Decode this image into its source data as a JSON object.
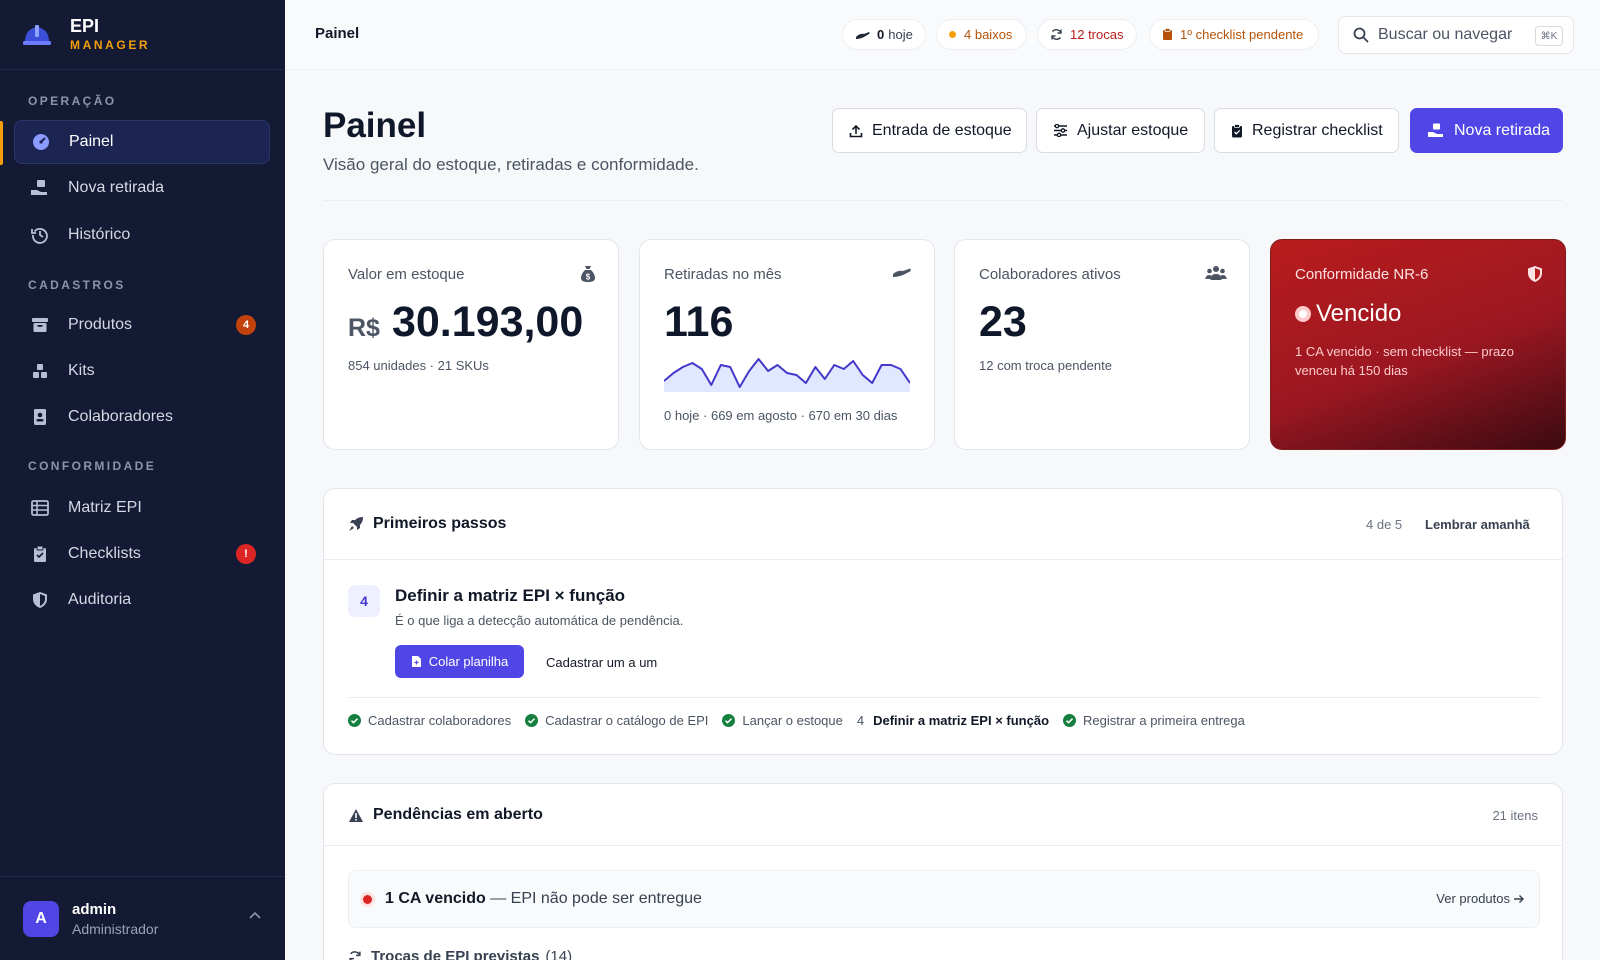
{
  "brand": {
    "name": "EPI",
    "sub": "MANAGER"
  },
  "nav": {
    "section_operacao": "OPERAÇÃO",
    "painel": "Painel",
    "nova_retirada": "Nova retirada",
    "historico": "Histórico",
    "section_cadastros": "CADASTROS",
    "produtos": "Produtos",
    "produtos_badge": "4",
    "kits": "Kits",
    "colaboradores": "Colaboradores",
    "section_conformidade": "CONFORMIDADE",
    "matriz": "Matriz EPI",
    "checklists": "Checklists",
    "checklists_badge": "!",
    "auditoria": "Auditoria"
  },
  "user": {
    "initial": "A",
    "name": "admin",
    "role": "Administrador"
  },
  "topbar": {
    "breadcrumb": "Painel",
    "pill_hoje_num": "0",
    "pill_hoje_label": "hoje",
    "pill_baixos": "4 baixos",
    "pill_trocas": "12 trocas",
    "pill_checklist": "1º checklist pendente",
    "search_placeholder": "Buscar ou navegar",
    "search_kbd": "⌘K"
  },
  "header": {
    "title": "Painel",
    "subtitle": "Visão geral do estoque, retiradas e conformidade.",
    "btn_entrada": "Entrada de estoque",
    "btn_ajustar": "Ajustar estoque",
    "btn_checklist": "Registrar checklist",
    "btn_nova": "Nova retirada"
  },
  "cards": {
    "valor": {
      "label": "Valor em estoque",
      "currency": "R$",
      "value": "30.193,00",
      "sub": "854 unidades · 21 SKUs"
    },
    "retiradas": {
      "label": "Retiradas no mês",
      "value": "116",
      "sub": "0 hoje · 669 em agosto · 670 em 30 dias"
    },
    "colaboradores": {
      "label": "Colaboradores ativos",
      "value": "23",
      "sub": "12 com troca pendente"
    },
    "conformidade": {
      "label": "Conformidade NR-6",
      "status": "Vencido",
      "sub1": "1 CA vencido · sem checklist — prazo",
      "sub2": "venceu há 150 dias"
    }
  },
  "sparkline": [
    4,
    8,
    11,
    13,
    10,
    2,
    12,
    11,
    1,
    9,
    15,
    9,
    12,
    8,
    7,
    3,
    11,
    5,
    12,
    10,
    14,
    7,
    3,
    12,
    12,
    10,
    3
  ],
  "onboarding": {
    "title": "Primeiros passos",
    "progress": "4 de 5",
    "remind": "Lembrar amanhã",
    "step_num": "4",
    "step_title": "Definir a matriz EPI × função",
    "step_desc": "É o que liga a detecção automática de pendência.",
    "btn_colar": "Colar planilha",
    "btn_cadastrar": "Cadastrar um a um",
    "steps": {
      "s1": "Cadastrar colaboradores",
      "s2": "Cadastrar o catálogo de EPI",
      "s3": "Lançar o estoque",
      "s4_num": "4",
      "s4": "Definir a matriz EPI × função",
      "s5": "Registrar a primeira entrega"
    }
  },
  "pendencias": {
    "title": "Pendências em aberto",
    "count": "21 itens",
    "item_bold": "1 CA vencido",
    "item_rest": " — EPI não pode ser entregue",
    "item_link": "Ver produtos",
    "next": "Trocas de EPI previstas",
    "next_count": "(14)"
  },
  "colors": {
    "accent": "#4f46e5",
    "sidebar": "#141a33",
    "danger": "#b91c1c",
    "warning": "#f59e0b",
    "success": "#15803d"
  }
}
